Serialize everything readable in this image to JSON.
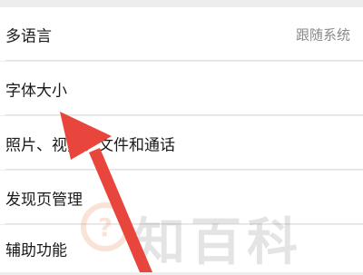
{
  "settings": {
    "items": [
      {
        "label": "多语言",
        "value": "跟随系统"
      },
      {
        "label": "字体大小"
      },
      {
        "label": "照片、视频、文件和通话"
      },
      {
        "label": "发现页管理"
      },
      {
        "label": "辅助功能"
      }
    ]
  },
  "overlay": {
    "watermark_text": "知百科",
    "arrow_color": "#e8453c",
    "watermark_icon": "question-circle-icon"
  }
}
